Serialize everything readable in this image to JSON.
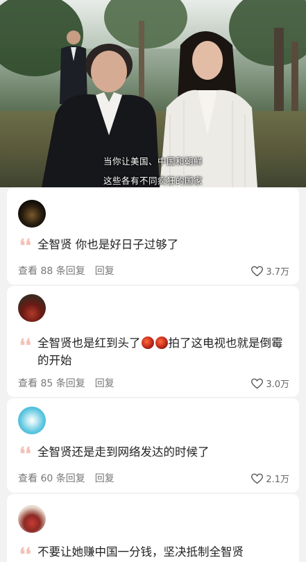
{
  "video": {
    "subtitle_line1": "当你让美国、中国和朝鲜",
    "subtitle_line2": "这些各有不同疯狂的国家"
  },
  "comments": [
    {
      "text": "全智贤 你也是好日子过够了",
      "view_replies": "查看 88 条回复",
      "reply_label": "回复",
      "likes": "3.7万"
    },
    {
      "text_part1": "全智贤也是红到头了",
      "text_part2": "拍了这电视也就是倒霉的开始",
      "emoji": [
        "fire-emoji",
        "fire-emoji"
      ],
      "view_replies": "查看 85 条回复",
      "reply_label": "回复",
      "likes": "3.0万"
    },
    {
      "text": "全智贤还是走到网络发达的时候了",
      "view_replies": "查看 60 条回复",
      "reply_label": "回复",
      "likes": "2.1万"
    },
    {
      "text": "不要让她赚中国一分钱，坚决抵制全智贤"
    }
  ],
  "colors": {
    "quote_mark": "#f4c2b8",
    "meta_text": "#777777",
    "card_bg": "#ffffff",
    "page_bg": "#f2f2f2"
  }
}
